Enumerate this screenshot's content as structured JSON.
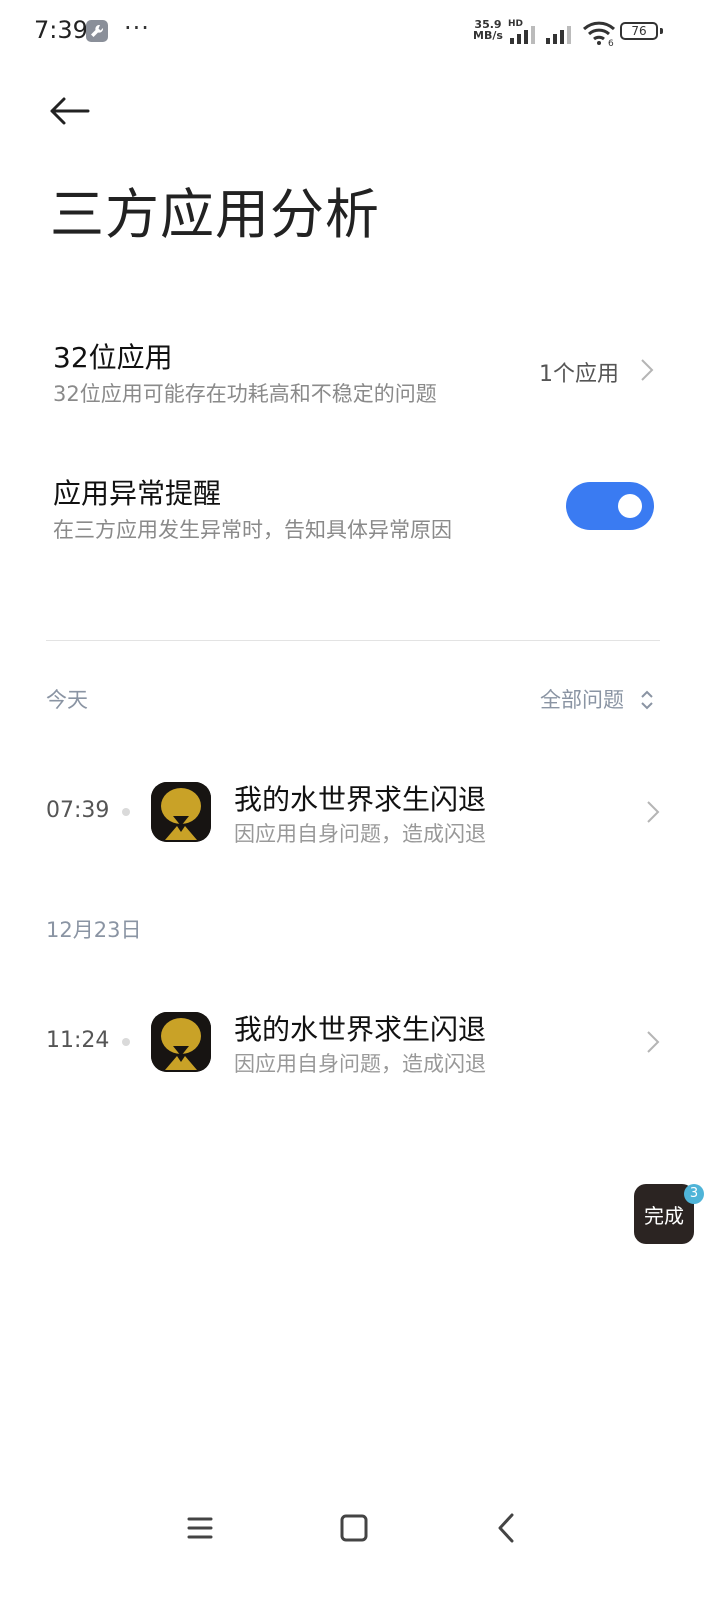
{
  "status_bar": {
    "time": "7:39",
    "more": "···",
    "net_speed_value": "35.9",
    "net_speed_unit": "MB/s",
    "hd": "HD",
    "wifi_number": "6",
    "battery": "76"
  },
  "header": {
    "back_icon": "arrow-left-icon",
    "title": "三方应用分析"
  },
  "settings": {
    "bit32": {
      "title": "32位应用",
      "subtitle": "32位应用可能存在功耗高和不稳定的问题",
      "value": "1个应用"
    },
    "alert": {
      "title": "应用异常提醒",
      "subtitle": "在三方应用发生异常时，告知具体异常原因",
      "enabled": true
    }
  },
  "filter": {
    "label": "全部问题",
    "icon": "sort-updown-icon"
  },
  "sections": [
    {
      "date": "今天",
      "items": [
        {
          "time": "07:39",
          "title": "我的水世界求生闪退",
          "subtitle": "因应用自身问题，造成闪退"
        }
      ]
    },
    {
      "date": "12月23日",
      "items": [
        {
          "time": "11:24",
          "title": "我的水世界求生闪退",
          "subtitle": "因应用自身问题，造成闪退"
        }
      ]
    }
  ],
  "floating": {
    "label": "完成",
    "badge": "3"
  },
  "nav": {
    "menu_icon": "menu-icon",
    "home_icon": "home-icon",
    "back_icon": "back-icon"
  },
  "colors": {
    "accent": "#3a7bf2",
    "secondary_text": "#8a94a3"
  }
}
